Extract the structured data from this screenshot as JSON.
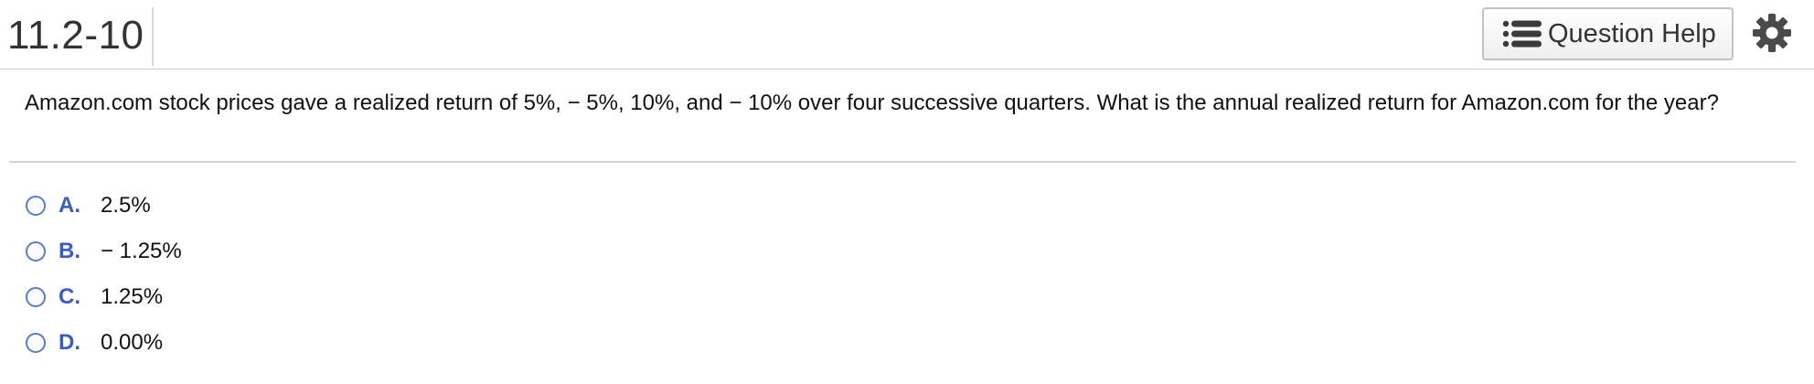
{
  "header": {
    "question_number": "11.2-10",
    "help_button_label": "Question Help"
  },
  "icons": {
    "help": "list-icon",
    "settings": "gear-icon"
  },
  "colors": {
    "accent": "#3b5bc4",
    "radio_border": "#5b7cc9"
  },
  "question": {
    "text": "Amazon.com stock prices gave a realized return of 5%,  − 5%, 10%, and  − 10% over four successive quarters.  What is the annual realized return for Amazon.com for the year?"
  },
  "options": [
    {
      "letter": "A.",
      "value": "2.5%"
    },
    {
      "letter": "B.",
      "value": " − 1.25%"
    },
    {
      "letter": "C.",
      "value": "1.25%"
    },
    {
      "letter": "D.",
      "value": "0.00%"
    }
  ]
}
